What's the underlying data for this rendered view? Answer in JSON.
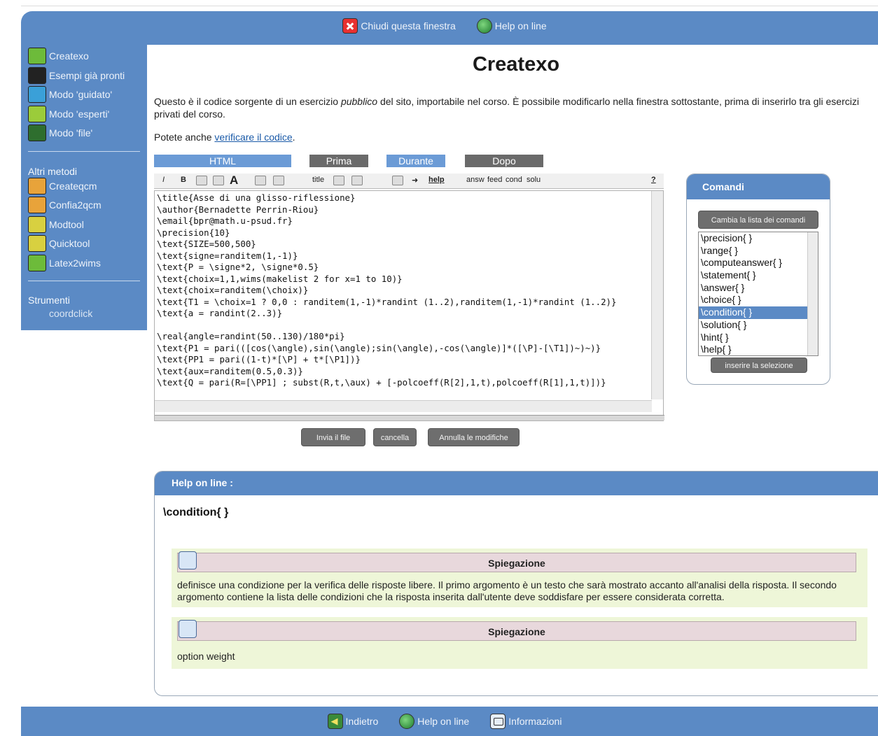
{
  "topbar": {
    "close_label": "Chiudi questa finestra",
    "help_label": "Help on line"
  },
  "sidebar": {
    "items": [
      {
        "label": "Createxo",
        "icon": "createxo-icon"
      },
      {
        "label": "Esempi già pronti",
        "icon": "examples-icon"
      },
      {
        "label": "Modo 'guidato'",
        "icon": "guided-icon"
      },
      {
        "label": "Modo 'esperti'",
        "icon": "expert-icon"
      },
      {
        "label": "Modo 'file'",
        "icon": "file-icon"
      }
    ],
    "other_heading": "Altri metodi",
    "other_items": [
      {
        "label": "Createqcm",
        "icon": "createqcm-icon"
      },
      {
        "label": "Confia2qcm",
        "icon": "confia2qcm-icon"
      },
      {
        "label": "Modtool",
        "icon": "modtool-icon"
      },
      {
        "label": "Quicktool",
        "icon": "quicktool-icon"
      },
      {
        "label": "Latex2wims",
        "icon": "latex2wims-icon"
      }
    ],
    "tools_heading": "Strumenti",
    "tools_items": [
      {
        "label": "coordclick"
      }
    ]
  },
  "main": {
    "title": "Createxo",
    "intro_before": "Questo è il codice sorgente di un esercizio ",
    "intro_em": "pubblico",
    "intro_after": " del sito, importabile nel corso. È possibile modificarlo nella finestra sottostante, prima di inserirlo tra gli esercizi privati del corso.",
    "also_text": "Potete anche ",
    "also_link": "verificare il codice",
    "also_end": "."
  },
  "tabs": [
    {
      "label": "HTML",
      "color": "#6b9bd6"
    },
    {
      "label": "Prima",
      "color": "#6a6a6a"
    },
    {
      "label": "Durante",
      "color": "#6b9bd6"
    },
    {
      "label": "Dopo",
      "color": "#6a6a6a"
    }
  ],
  "toolbar": {
    "italic": "I",
    "bold": "B",
    "title": "title",
    "help": "help",
    "answ": "answ",
    "feed": "feed",
    "cond": "cond",
    "solu": "solu",
    "question": "?"
  },
  "editor": {
    "code": "\\title{Asse di una glisso-riflessione}\n\\author{Bernadette Perrin-Riou}\n\\email{bpr@math.u-psud.fr}\n\\precision{10}\n\\text{SIZE=500,500}\n\\text{signe=randitem(1,-1)}\n\\text{P = \\signe*2, \\signe*0.5}\n\\text{choix=1,1,wims(makelist 2 for x=1 to 10)}\n\\text{choix=randitem(\\choix)}\n\\text{T1 = \\choix=1 ? 0,0 : randitem(1,-1)*randint (1..2),randitem(1,-1)*randint (1..2)}\n\\text{a = randint(2..3)}\n\n\\real{angle=randint(50..130)/180*pi}\n\\text{P1 = pari(([cos(\\angle),sin(\\angle);sin(\\angle),-cos(\\angle)]*([\\P]-[\\T1])~)~)}\n\\text{PP1 = pari((1-t)*[\\P] + t*[\\P1])}\n\\text{aux=randitem(0.5,0.3)}\n\\text{Q = pari(R=[\\PP1] ; subst(R,t,\\aux) + [-polcoeff(R[2],1,t),polcoeff(R[1],1,t)])}"
  },
  "buttons": {
    "send": "Invia il file",
    "cancel": "cancella",
    "undo": "Annulla le modifiche"
  },
  "comandi": {
    "title": "Comandi",
    "change_list": "Cambia la lista dei comandi",
    "options": [
      "\\precision{ }",
      "\\range{ }",
      "\\computeanswer{ }",
      "\\statement{ }",
      "\\answer{ }",
      "\\choice{ }",
      "\\condition{ }",
      "\\solution{ }",
      "\\hint{ }",
      "\\help{ }"
    ],
    "selected": "\\condition{ }",
    "insert": "inserire la selezione"
  },
  "help": {
    "header": "Help on line :",
    "command": "\\condition{ }",
    "sections": [
      {
        "heading": "Spiegazione",
        "text": "definisce una condizione per la verifica delle risposte libere. Il primo argomento è un testo che sarà mostrato accanto all'analisi della risposta. Il secondo argomento contiene la lista delle condizioni che la risposta inserita dall'utente deve soddisfare per essere considerata corretta."
      },
      {
        "heading": "Spiegazione",
        "text": "option weight"
      }
    ]
  },
  "bottombar": {
    "back": "Indietro",
    "help": "Help on line",
    "info": "Informazioni"
  }
}
